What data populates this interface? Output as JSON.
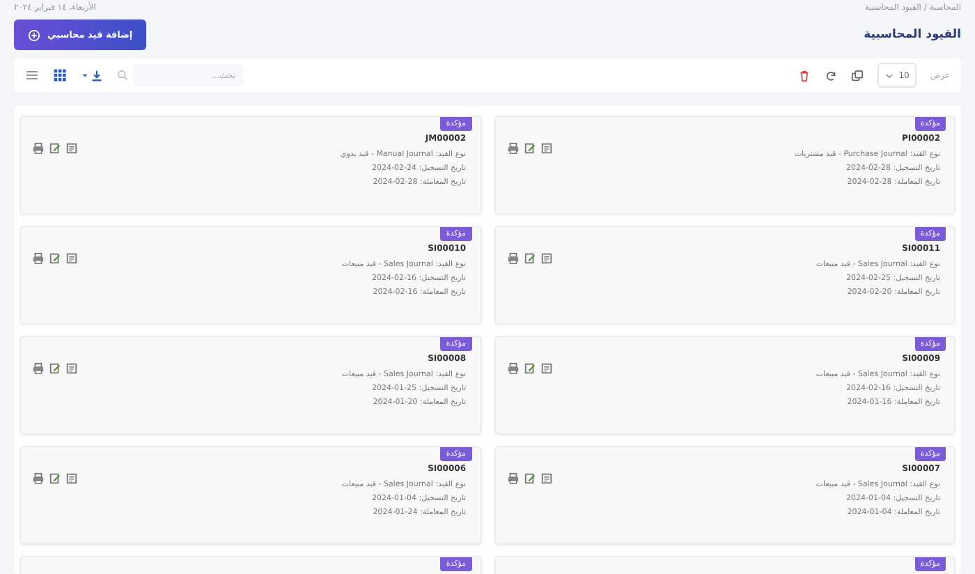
{
  "header": {
    "breadcrumb": "المحاسبة / القيود المحاسبية",
    "date": "الأربعاء، ١٤ فبراير ٢٠٢٤",
    "title": "القيود المحاسبية",
    "add_button": "إضافة قيد محاسبي"
  },
  "toolbar": {
    "show_label": "عرض",
    "page_size": "10",
    "search": {
      "placeholder": "بحث..."
    },
    "views": [
      {
        "kind": "grid",
        "selected": true
      },
      {
        "kind": "list",
        "selected": false
      }
    ]
  },
  "entries": [
    {
      "badge": "مؤكدة",
      "code": "PI00002",
      "type": "نوع القيد: Purchase Journal - قيد مشتريات",
      "registered": "تاريخ التسجيل: 28-02-2024",
      "transaction": "تاريخ المعاملة: 28-02-2024"
    },
    {
      "badge": "مؤكدة",
      "code": "JM00002",
      "type": "نوع القيد: Manual Journal - قيد يدوي",
      "registered": "تاريخ التسجيل: 24-02-2024",
      "transaction": "تاريخ المعاملة: 28-02-2024"
    },
    {
      "badge": "مؤكدة",
      "code": "SI00011",
      "type": "نوع القيد: Sales Journal - قيد مبيعات",
      "registered": "تاريخ التسجيل: 25-02-2024",
      "transaction": "تاريخ المعاملة: 20-02-2024"
    },
    {
      "badge": "مؤكدة",
      "code": "SI00010",
      "type": "نوع القيد: Sales Journal - قيد مبيعات",
      "registered": "تاريخ التسجيل: 16-02-2024",
      "transaction": "تاريخ المعاملة: 16-02-2024"
    },
    {
      "badge": "مؤكدة",
      "code": "SI00009",
      "type": "نوع القيد: Sales Journal - قيد مبيعات",
      "registered": "تاريخ التسجيل: 16-02-2024",
      "transaction": "تاريخ المعاملة: 16-01-2024"
    },
    {
      "badge": "مؤكدة",
      "code": "SI00008",
      "type": "نوع القيد: Sales Journal - قيد مبيعات",
      "registered": "تاريخ التسجيل: 25-01-2024",
      "transaction": "تاريخ المعاملة: 20-01-2024"
    },
    {
      "badge": "مؤكدة",
      "code": "SI00007",
      "type": "نوع القيد: Sales Journal - قيد مبيعات",
      "registered": "تاريخ التسجيل: 04-01-2024",
      "transaction": "تاريخ المعاملة: 04-01-2024"
    },
    {
      "badge": "مؤكدة",
      "code": "SI00006",
      "type": "نوع القيد: Sales Journal - قيد مبيعات",
      "registered": "تاريخ التسجيل: 04-01-2024",
      "transaction": "تاريخ المعاملة: 24-01-2024"
    },
    {
      "badge": "مؤكدة"
    },
    {
      "badge": "مؤكدة"
    }
  ]
}
